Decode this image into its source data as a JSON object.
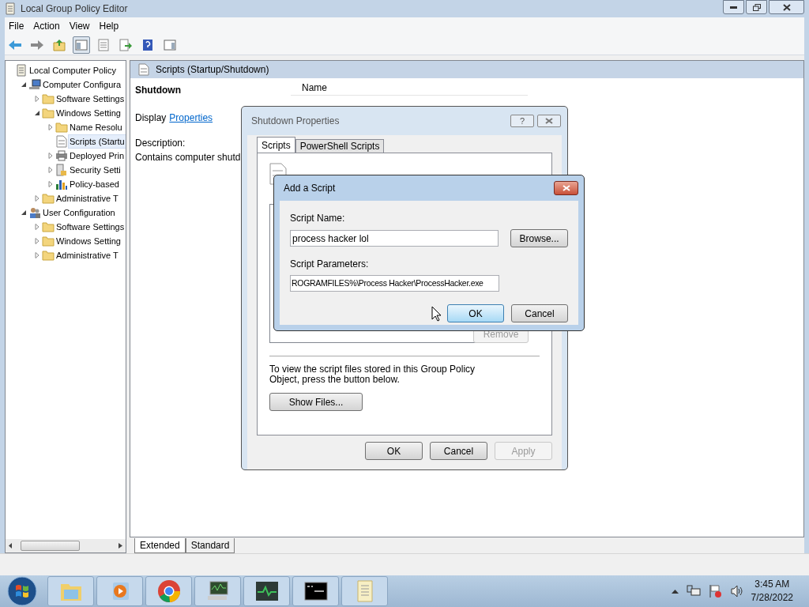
{
  "window": {
    "title": "Local Group Policy Editor"
  },
  "menu": [
    "File",
    "Action",
    "View",
    "Help"
  ],
  "toolbar": [
    {
      "kind": "back",
      "pressed": false
    },
    {
      "kind": "forward",
      "pressed": false
    },
    {
      "kind": "up",
      "pressed": false
    },
    {
      "kind": "tree",
      "pressed": true
    },
    {
      "kind": "properties",
      "pressed": false
    },
    {
      "kind": "export",
      "pressed": false
    },
    {
      "kind": "help",
      "pressed": false
    },
    {
      "kind": "pane",
      "pressed": false
    }
  ],
  "tree": [
    {
      "label": "Local Computer Policy",
      "kind": "policy",
      "selected": false,
      "children": [
        {
          "label": "Computer Configura",
          "kind": "computer",
          "expanded": true,
          "selected": false,
          "children": [
            {
              "label": "Software Settings",
              "kind": "folder",
              "expanded": false,
              "selected": false
            },
            {
              "label": "Windows Setting",
              "kind": "folder",
              "expanded": true,
              "selected": false,
              "children": [
                {
                  "label": "Name Resolu",
                  "kind": "folder",
                  "expanded": false,
                  "selected": false
                },
                {
                  "label": "Scripts (Startu",
                  "kind": "script",
                  "selected": true
                },
                {
                  "label": "Deployed Prin",
                  "kind": "printer",
                  "expanded": false,
                  "selected": false
                },
                {
                  "label": "Security Setti",
                  "kind": "security",
                  "expanded": false,
                  "selected": false
                },
                {
                  "label": "Policy-based",
                  "kind": "chart",
                  "expanded": false,
                  "selected": false
                }
              ]
            },
            {
              "label": "Administrative T",
              "kind": "folder",
              "expanded": false,
              "selected": false
            }
          ]
        },
        {
          "label": "User Configuration",
          "kind": "user",
          "expanded": true,
          "selected": false,
          "children": [
            {
              "label": "Software Settings",
              "kind": "folder",
              "expanded": false,
              "selected": false
            },
            {
              "label": "Windows Setting",
              "kind": "folder",
              "expanded": false,
              "selected": false
            },
            {
              "label": "Administrative T",
              "kind": "folder",
              "expanded": false,
              "selected": false
            }
          ]
        }
      ]
    }
  ],
  "detail": {
    "header": "Scripts (Startup/Shutdown)",
    "heading": "Shutdown",
    "display_prefix": "Display",
    "display_link": "Properties",
    "description_label": "Description:",
    "description": "Contains computer shutd",
    "column": "Name"
  },
  "view_tabs": [
    {
      "label": "Extended",
      "selected": true
    },
    {
      "label": "Standard",
      "selected": false
    }
  ],
  "shutdown_dialog": {
    "title": "Shutdown Properties",
    "help": "?",
    "tabs": [
      {
        "label": "Scripts",
        "selected": true
      },
      {
        "label": "PowerShell Scripts",
        "selected": false
      }
    ],
    "remove": {
      "label": "Remove",
      "disabled": true
    },
    "note": "To view the script files stored in this Group Policy Object, press the button below.",
    "show_files": "Show Files...",
    "buttons": [
      {
        "label": "OK",
        "disabled": false
      },
      {
        "label": "Cancel",
        "disabled": false
      },
      {
        "label": "Apply",
        "disabled": true
      }
    ]
  },
  "add_dialog": {
    "title": "Add a Script",
    "name_label": "Script Name:",
    "name_value": "process hacker lol",
    "browse": "Browse...",
    "params_label": "Script Parameters:",
    "params_value": "ROGRAMFILES%\\Process Hacker\\ProcessHacker.exe",
    "buttons": [
      {
        "label": "OK",
        "default": true
      },
      {
        "label": "Cancel",
        "default": false
      }
    ]
  },
  "taskbar": [
    {
      "kind": "explorer"
    },
    {
      "kind": "media"
    },
    {
      "kind": "browser"
    },
    {
      "kind": "monitor"
    },
    {
      "kind": "pulse"
    },
    {
      "kind": "console"
    },
    {
      "kind": "notes"
    }
  ],
  "clock": {
    "time": "3:45 AM",
    "date": "7/28/2022"
  }
}
